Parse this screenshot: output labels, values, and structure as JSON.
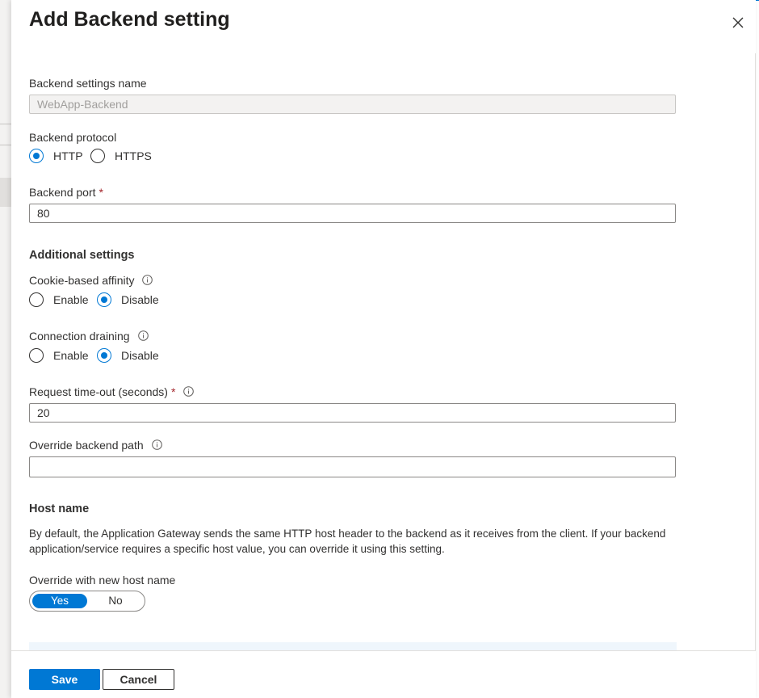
{
  "panel": {
    "title": "Add Backend setting",
    "close_icon": "close-icon"
  },
  "form": {
    "name": {
      "label": "Backend settings name",
      "value": "WebApp-Backend"
    },
    "protocol": {
      "label": "Backend protocol",
      "options": [
        "HTTP",
        "HTTPS"
      ],
      "selected": "HTTP"
    },
    "port": {
      "label": "Backend port",
      "required_mark": "*",
      "value": "80"
    },
    "additional": {
      "heading": "Additional settings",
      "cookie_affinity": {
        "label": "Cookie-based affinity",
        "options": [
          "Enable",
          "Disable"
        ],
        "selected": "Disable"
      },
      "connection_draining": {
        "label": "Connection draining",
        "options": [
          "Enable",
          "Disable"
        ],
        "selected": "Disable"
      },
      "timeout": {
        "label": "Request time-out (seconds)",
        "required_mark": "*",
        "value": "20"
      },
      "override_path": {
        "label": "Override backend path",
        "value": ""
      }
    },
    "host_name": {
      "heading": "Host name",
      "description": "By default, the Application Gateway sends the same HTTP host header to the backend as it receives from the client. If your backend application/service requires a specific host value, you can override it using this setting.",
      "override_label": "Override with new host name",
      "toggle_options": [
        "Yes",
        "No"
      ],
      "selected": "Yes"
    }
  },
  "footer": {
    "save_label": "Save",
    "cancel_label": "Cancel"
  },
  "colors": {
    "accent": "#0078d4",
    "required": "#a4262c"
  }
}
